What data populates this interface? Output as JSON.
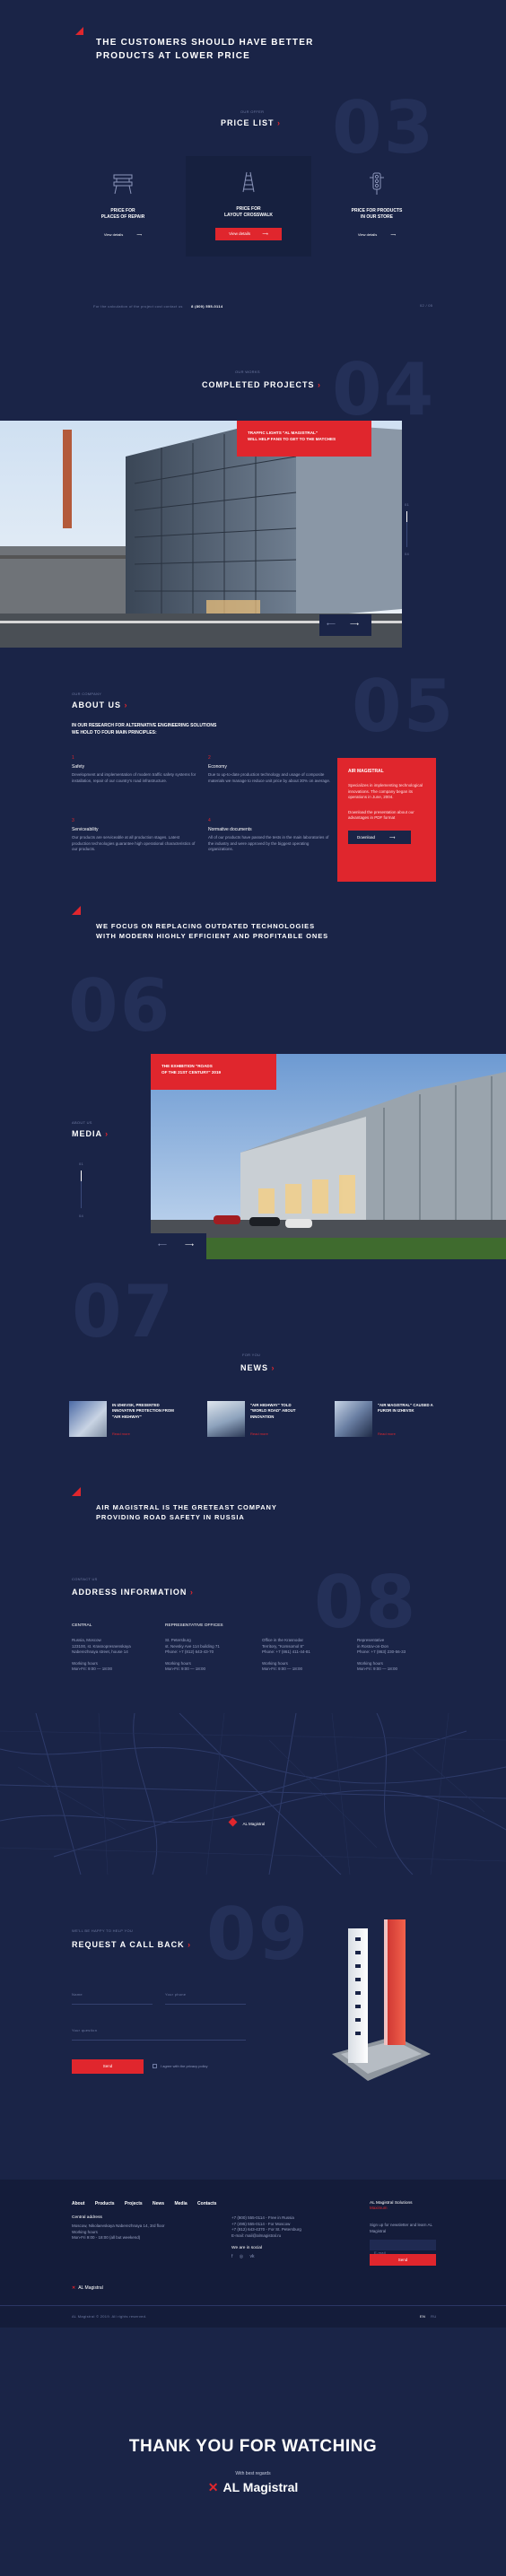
{
  "hero": {
    "title_line1": "THE CUSTOMERS SHOULD HAVE BETTER",
    "title_line2": "PRODUCTS AT LOWER PRICE"
  },
  "price": {
    "kicker": "OUR OFFER",
    "title": "PRICE LIST",
    "num": "03",
    "cards": [
      {
        "line1": "PRICE FOR",
        "line2": "PLACES OF REPAIR",
        "link": "View details"
      },
      {
        "line1": "PRICE FOR",
        "line2": "LAYOUT CROSSWALK",
        "link": "View details"
      },
      {
        "line1": "PRICE FOR PRODUCTS",
        "line2": "IN OUR STORE",
        "link": "View details"
      }
    ],
    "footnote": "For the calculation of the project cost contact us",
    "phone": "8 (800) 555-0114",
    "pager": "02 / 05"
  },
  "projects": {
    "kicker": "OUR WORKS",
    "title": "COMPLETED PROJECTS",
    "num": "04",
    "caption_line1": "TRAFFIC LIGHTS \"AL MAGISTRAL\"",
    "caption_line2": "WILL HELP FANS TO GET TO THE MATCHES",
    "counter_top": "01",
    "counter_bottom": "04"
  },
  "about": {
    "kicker": "OUR COMPANY",
    "title": "ABOUT US",
    "num": "05",
    "intro_line1": "IN OUR RESEARCH FOR ALTERNATIVE ENGINEERING SOLUTIONS",
    "intro_line2": "WE HOLD TO FOUR MAIN PRINCIPLES:",
    "principles": [
      {
        "n": "1",
        "title": "Safety",
        "text": "Development and implementation of modern traffic safety systems for installation, repair of our country's road infrastructure."
      },
      {
        "n": "2",
        "title": "Economy",
        "text": "Due to up-to-date production technology and usage of composite materials we manage to reduce unit price by about 30% on average."
      },
      {
        "n": "3",
        "title": "Serviceability",
        "text": "Our products are serviceable at all production stages. Latest production technologies guarantee high operational characteristics of our products."
      },
      {
        "n": "4",
        "title": "Normative documents",
        "text": "All of our products have passed the tests in the main laboratories of the industry and were approved by the biggest operating organizations."
      }
    ],
    "card": {
      "title": "AIR MAGISTRAL",
      "text1": "Specializes in implementing technological innovations. The company began its operations in June, 2004.",
      "text2": "Download the presentation about our advantages in PDF format",
      "button": "Download"
    }
  },
  "media": {
    "slogan_line1": "WE FOCUS ON REPLACING OUTDATED TECHNOLOGIES",
    "slogan_line2": "WITH MODERN HIGHLY EFFICIENT  AND PROFITABLE ONES",
    "num": "06",
    "kicker": "ABOUT US",
    "title": "MEDIA",
    "counter_top": "01",
    "counter_bottom": "04",
    "caption_line1": "THE EXHIBITION \"ROADS",
    "caption_line2": "OF THE 21ST CENTURY\" 2019"
  },
  "news": {
    "kicker": "FOR YOU",
    "title": "NEWS",
    "num": "07",
    "items": [
      {
        "title": "IN IZHEVSK, PRESENTED INNOVATIVE PROTECTION FROM \"AIR HIGHWAY\"",
        "tag": "Read more"
      },
      {
        "title": "\"AIR HIGHWAY\" TOLD \"WORLD ROAD\" ABOUT INNOVATION",
        "tag": "Read more"
      },
      {
        "title": "\"AIR MAGISTRAL\" CAUSED A FUROR IN IZHEVSK",
        "tag": "Read more"
      }
    ]
  },
  "mission": {
    "line1": "AIR MAGISTRAL IS THE GRETEAST COMPANY",
    "line2": "PROVIDING ROAD SAFETY IN RUSSIA"
  },
  "address": {
    "kicker": "CONTACT US",
    "title": "ADDRESS INFORMATION",
    "num": "08",
    "columns": [
      {
        "head": "CENTRAL",
        "lines": [
          "Russia, Moscow",
          "123100, st. Krasnopresnenskaya",
          "Naberezhnaya street, house 14"
        ],
        "hours_label": "Working hours",
        "hours": "Mon-Fri: 9:00 — 18:00"
      },
      {
        "head": "REPRESENTATIVE OFFICES",
        "lines": [
          "St. Petersburg",
          "st. Nevsky Ave 114 building 71",
          "Phone: +7 (812) 643-43-70"
        ],
        "hours_label": "Working hours",
        "hours": "Mon-Fri: 9:00 — 18:00"
      },
      {
        "head": "",
        "lines": [
          "Office in the Krasnodar",
          "Territory, \"Komsomol 8\"",
          "Phone: +7 (861) 411-44-81"
        ],
        "hours_label": "Working hours",
        "hours": "Mon-Fri: 9:00 — 18:00"
      },
      {
        "head": "",
        "lines": [
          "Representative",
          "in Rostov-on-Don",
          "Phone: +7 (863) 230-56-33"
        ],
        "hours_label": "Working hours",
        "hours": "Mon-Fri: 9:00 — 18:00"
      }
    ],
    "map_pin_label": "AL Magistral"
  },
  "callback": {
    "kicker": "WE'LL BE HAPPY TO HELP YOU",
    "title": "REQUEST A CALL BACK",
    "num": "09",
    "name_placeholder": "Name",
    "phone_placeholder": "Your phone",
    "question_placeholder": "Your question",
    "button": "Send",
    "consent": "I agree with the privacy policy"
  },
  "footer": {
    "nav": [
      "About",
      "Products",
      "Projects",
      "News",
      "Media",
      "Contacts"
    ],
    "central_label": "Central address",
    "address_lines": [
      "Moscow, Nikolaevskaya Naberezhnaya 14, 3rd floor",
      "Working hours",
      "Mon-Fri 9:00 - 18:00 (all but weekend)"
    ],
    "phones": [
      "+7 (800) 555-0114 - Free in Russia",
      "+7 (495) 555-0114 - For Moscow",
      "+7 (812) 643-4370 - For St. Petersburg",
      "E-mail: mail@almagistral.ru"
    ],
    "social_label": "We are in social",
    "brand_title": "AL Magistral Solutions",
    "brand_sub": "Maximum",
    "subscribe_text": "Sign up for newsletter and learn AL Magistral",
    "email_placeholder": "E-mail",
    "subscribe_button": "Send",
    "logo": "AL Magistral",
    "copyright": "AL Magistral © 2019. All rights reserved.",
    "lang": [
      "EN",
      "RU"
    ]
  },
  "thanks": {
    "title": "THANK YOU FOR WATCHING",
    "regards": "With best regards",
    "logo": "AL Magistral"
  }
}
